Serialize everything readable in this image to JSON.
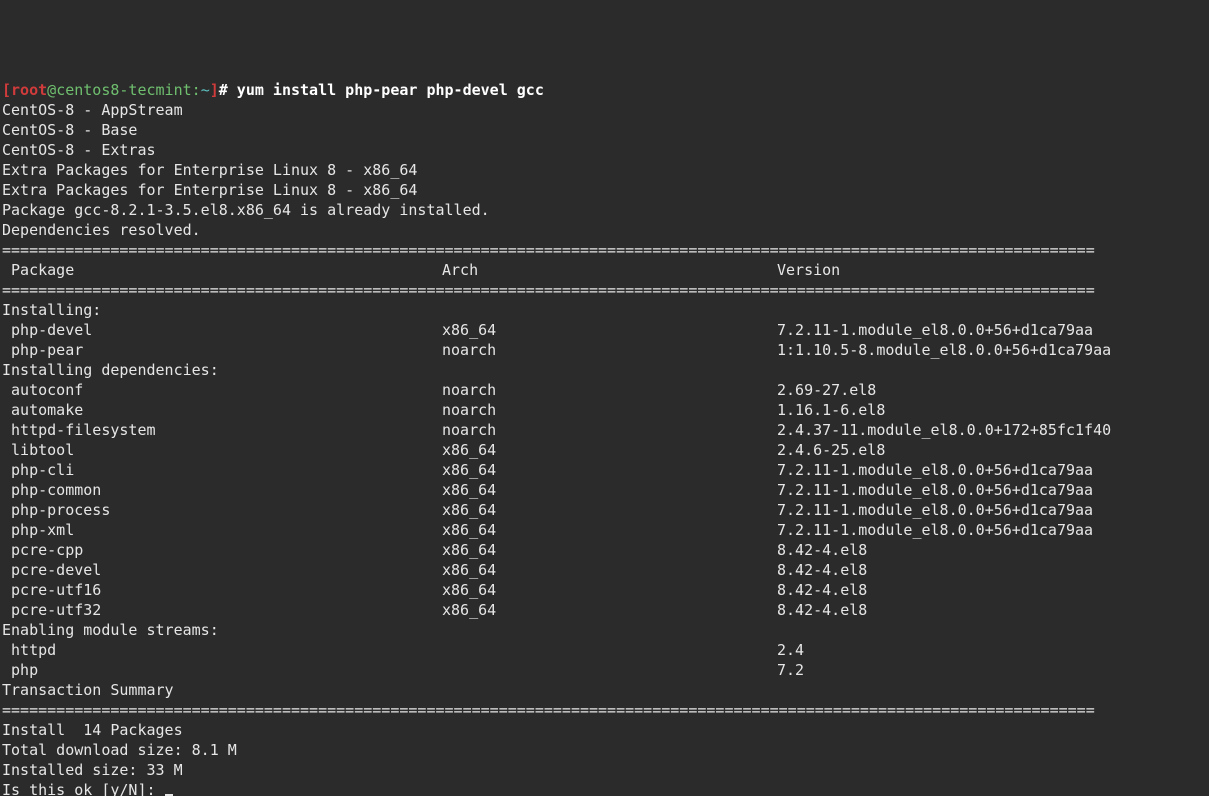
{
  "prompt": {
    "bracket_open": "[",
    "user": "root",
    "at": "@",
    "host": "centos8-tecmint",
    "colon": ":",
    "path": "~",
    "bracket_close": "]",
    "hash": "#",
    "command": " yum install php-pear php-devel gcc"
  },
  "repos": [
    "CentOS-8 - AppStream",
    "CentOS-8 - Base",
    "CentOS-8 - Extras",
    "Extra Packages for Enterprise Linux 8 - x86_64",
    "Extra Packages for Enterprise Linux 8 - x86_64"
  ],
  "already_installed": "Package gcc-8.2.1-3.5.el8.x86_64 is already installed.",
  "deps_resolved": "Dependencies resolved.",
  "rule": "=========================================================================================================================",
  "headers": {
    "pkg": " Package",
    "arch": "Arch",
    "ver": "Version"
  },
  "sections": {
    "installing": "Installing:",
    "installing_deps": "Installing dependencies:",
    "enabling": "Enabling module streams:"
  },
  "installing": [
    {
      "name": " php-devel",
      "arch": "x86_64",
      "ver": "7.2.11-1.module_el8.0.0+56+d1ca79aa"
    },
    {
      "name": " php-pear",
      "arch": "noarch",
      "ver": "1:1.10.5-8.module_el8.0.0+56+d1ca79aa"
    }
  ],
  "deps": [
    {
      "name": " autoconf",
      "arch": "noarch",
      "ver": "2.69-27.el8"
    },
    {
      "name": " automake",
      "arch": "noarch",
      "ver": "1.16.1-6.el8"
    },
    {
      "name": " httpd-filesystem",
      "arch": "noarch",
      "ver": "2.4.37-11.module_el8.0.0+172+85fc1f40"
    },
    {
      "name": " libtool",
      "arch": "x86_64",
      "ver": "2.4.6-25.el8"
    },
    {
      "name": " php-cli",
      "arch": "x86_64",
      "ver": "7.2.11-1.module_el8.0.0+56+d1ca79aa"
    },
    {
      "name": " php-common",
      "arch": "x86_64",
      "ver": "7.2.11-1.module_el8.0.0+56+d1ca79aa"
    },
    {
      "name": " php-process",
      "arch": "x86_64",
      "ver": "7.2.11-1.module_el8.0.0+56+d1ca79aa"
    },
    {
      "name": " php-xml",
      "arch": "x86_64",
      "ver": "7.2.11-1.module_el8.0.0+56+d1ca79aa"
    },
    {
      "name": " pcre-cpp",
      "arch": "x86_64",
      "ver": "8.42-4.el8"
    },
    {
      "name": " pcre-devel",
      "arch": "x86_64",
      "ver": "8.42-4.el8"
    },
    {
      "name": " pcre-utf16",
      "arch": "x86_64",
      "ver": "8.42-4.el8"
    },
    {
      "name": " pcre-utf32",
      "arch": "x86_64",
      "ver": "8.42-4.el8"
    }
  ],
  "streams": [
    {
      "name": " httpd",
      "arch": "",
      "ver": "2.4"
    },
    {
      "name": " php",
      "arch": "",
      "ver": "7.2"
    }
  ],
  "summary_title": "Transaction Summary",
  "summary_line": "Install  14 Packages",
  "total_dl": "Total download size: 8.1 M",
  "installed_size": "Installed size: 33 M",
  "confirm": "Is this ok [y/N]: "
}
